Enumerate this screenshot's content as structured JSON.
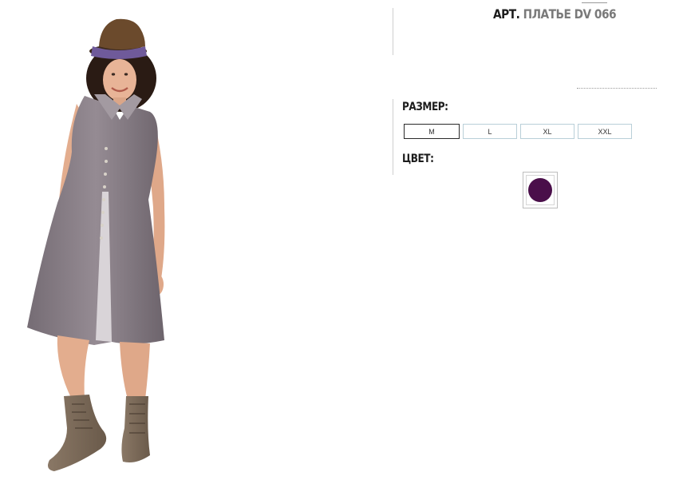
{
  "product": {
    "title_prefix": "АРТ.",
    "title_name": "ПЛАТЬЕ DV 066",
    "image_alt": "model wearing grey linen sleeveless dress, brown hat and lace-up boots"
  },
  "size_section": {
    "label": "РАЗМЕР:",
    "options": [
      "M",
      "L",
      "XL",
      "XXL"
    ],
    "selected": "M"
  },
  "color_section": {
    "label": "ЦВЕТ:",
    "swatch_color": "#4a0f4a"
  },
  "colors": {
    "dress": "#8a8088",
    "hat": "#6b4a2c",
    "boots": "#7c6a58",
    "skin": "#e8b497",
    "hair": "#2a1b14"
  }
}
